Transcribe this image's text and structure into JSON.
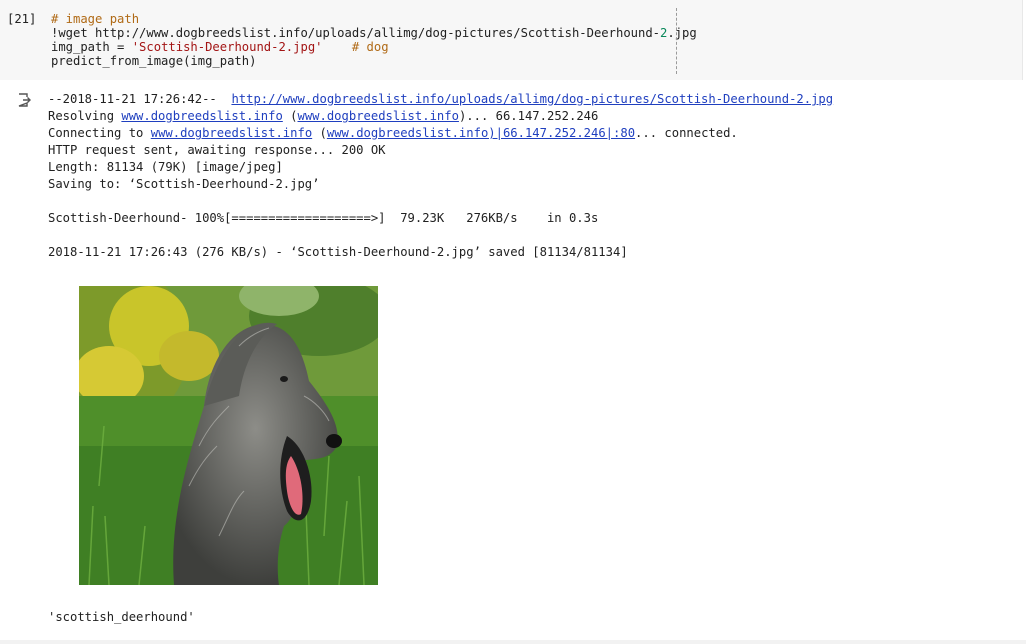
{
  "cell": {
    "prompt": "[21]",
    "code": {
      "comment": "# image path",
      "wget_cmd": "!wget http://www.dogbreedslist.info/uploads/allimg/dog-pictures/Scottish-Deerhound-",
      "wget_num": "2",
      "wget_ext": ".jpg",
      "assign_prefix": "img_path = ",
      "assign_value": "'Scottish-Deerhound-2.jpg'",
      "assign_gap": "    ",
      "assign_comment": "# dog",
      "call": "predict_from_image(img_path)"
    }
  },
  "output": {
    "timestamp_line": "--2018-11-21 17:26:42--  ",
    "timestamp_url": "http://www.dogbreedslist.info/uploads/allimg/dog-pictures/Scottish-Deerhound-2.jpg",
    "resolving_prefix": "Resolving ",
    "resolving_host": "www.dogbreedslist.info",
    "resolving_mid": " (",
    "resolving_host2": "www.dogbreedslist.info",
    "resolving_suffix": ")... 66.147.252.246",
    "connecting_prefix": "Connecting to ",
    "connecting_host": "www.dogbreedslist.info",
    "connecting_mid": " (",
    "connecting_host2": "www.dogbreedslist.info)|66.147.252.246|:80",
    "connecting_suffix": "... connected.",
    "http_line": "HTTP request sent, awaiting response... 200 OK",
    "length_line": "Length: 81134 (79K) [image/jpeg]",
    "saving_line": "Saving to: ‘Scottish-Deerhound-2.jpg’",
    "progress_line": "Scottish-Deerhound- 100%[===================>]  79.23K   276KB/s    in 0.3s",
    "saved_line": "2018-11-21 17:26:43 (276 KB/s) - ‘Scottish-Deerhound-2.jpg’ saved [81134/81134]",
    "result": "'scottish_deerhound'"
  },
  "icons": {
    "output": "output-redirect-icon"
  },
  "colors": {
    "comment": "#b06a16",
    "string": "#a31515",
    "number": "#09885a",
    "link": "#1f3fbf",
    "cell_bg": "#f7f7f7"
  }
}
